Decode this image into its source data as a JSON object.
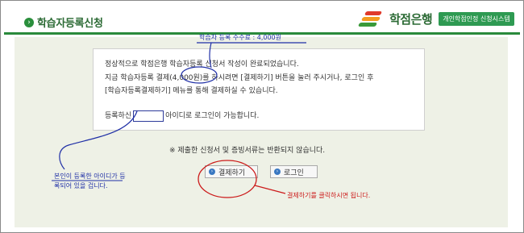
{
  "header": {
    "title": "학습자등록신청",
    "brand_name": "학점은행",
    "badge": "개인학점인정 신청시스템"
  },
  "notice": {
    "line1": "정상적으로 학점은행 학습자등록 신청서 작성이 완료되었습니다.",
    "line2": "지금 학습자등록 결제(4,000원)를 하시려면 [결제하기] 버튼을 눌러 주시거나, 로그인 후",
    "line3": "[학습자등록결제하기] 메뉴를 통해 결제하실 수 있습니다.",
    "line4_before": "등록하신",
    "line4_after": "아이디로 로그인이 가능합니다."
  },
  "warning": "※ 제출한 신청서 및 증빙서류는 반환되지 않습니다.",
  "buttons": {
    "pay": "결제하기",
    "login": "로그인"
  },
  "annotations": {
    "fee": "학습자 등록 수수료 : 4,000원",
    "id_line1": "본인이 등록한 아이디가 등",
    "id_line2": "록되어 있을 겁니다.",
    "click": "결제하기를 클릭하시면 됩니다."
  },
  "colors": {
    "brand_green": "#2b6a34",
    "annotation_blue": "#1f2fa6",
    "annotation_red": "#cc1b1b",
    "content_bg": "#eef1e6"
  }
}
